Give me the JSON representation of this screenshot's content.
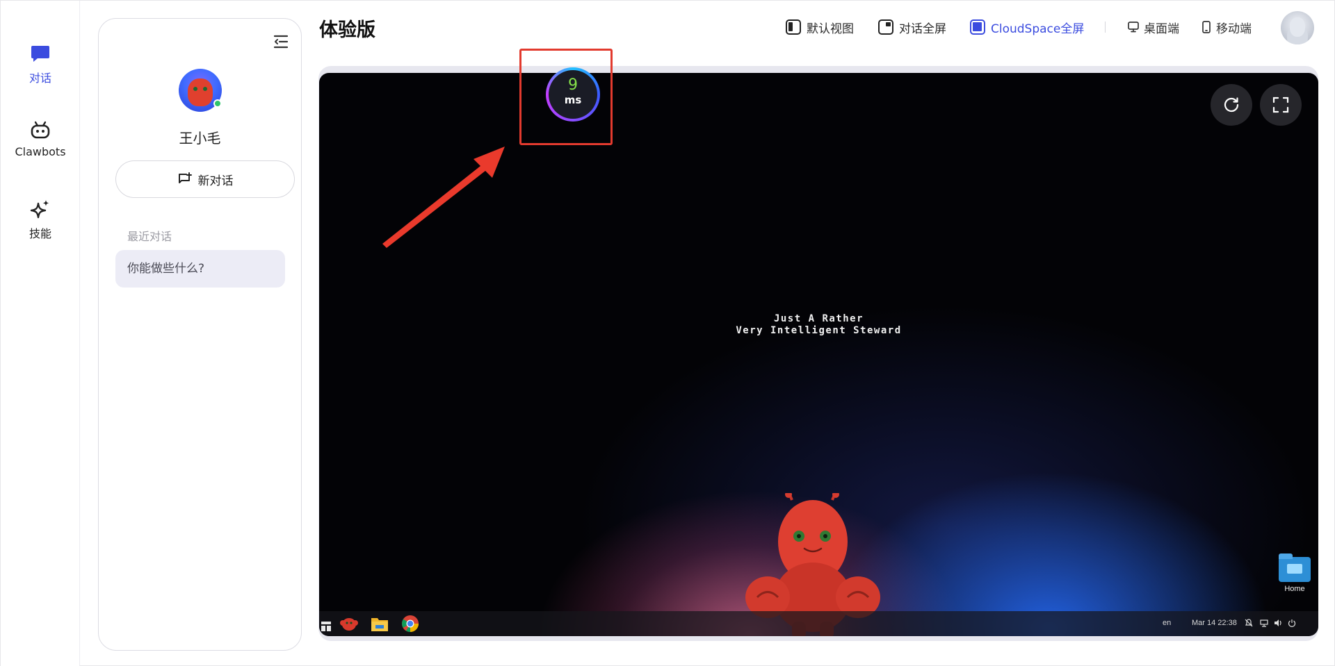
{
  "rail": {
    "items": [
      {
        "label": "对话",
        "icon": "chat-bubble-icon"
      },
      {
        "label": "Clawbots",
        "icon": "bot-icon"
      },
      {
        "label": "技能",
        "icon": "sparkle-icon"
      }
    ]
  },
  "sidebar": {
    "user_name": "王小毛",
    "new_chat_label": "新对话",
    "recent_label": "最近对话",
    "recent_items": [
      "你能做些什么?"
    ]
  },
  "header": {
    "title": "体验版",
    "view_modes": [
      {
        "label": "默认视图"
      },
      {
        "label": "对话全屏"
      },
      {
        "label": "CloudSpace全屏"
      }
    ],
    "devices": [
      {
        "label": "桌面端"
      },
      {
        "label": "移动端"
      }
    ]
  },
  "latency": {
    "value": "9",
    "unit": "ms"
  },
  "desktop": {
    "tagline_line1": "Just A Rather",
    "tagline_line2": "Very Intelligent Steward",
    "home_icon_label": "Home",
    "tray": {
      "lang": "en",
      "datetime": "Mar 14  22:38"
    }
  },
  "colors": {
    "accent": "#3b4cdf",
    "annotation": "#e23a2e",
    "latency_value": "#86e34a"
  }
}
